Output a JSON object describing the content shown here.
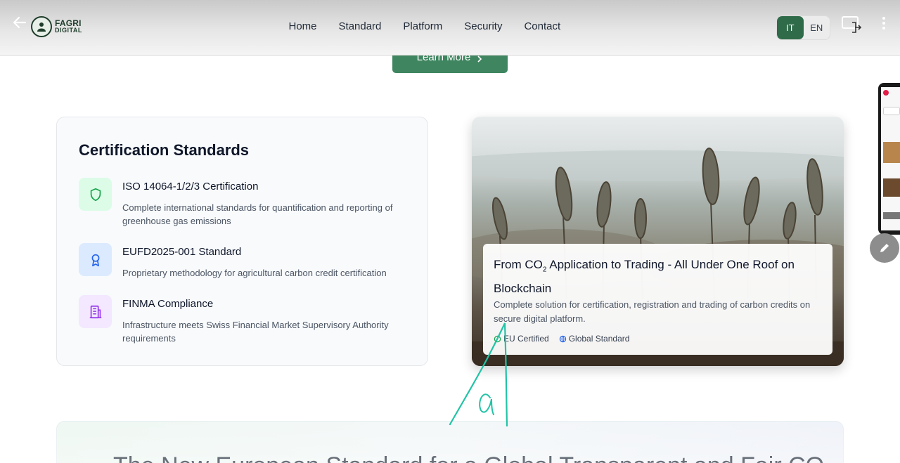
{
  "header": {
    "logo": {
      "line1": "FAGRI",
      "line2": "DIGITAL"
    },
    "nav": [
      "Home",
      "Standard",
      "Platform",
      "Security",
      "Contact"
    ],
    "lang": {
      "active": "IT",
      "inactive": "EN"
    }
  },
  "hero": {
    "learn_more": "Learn More"
  },
  "certification": {
    "title": "Certification Standards",
    "items": [
      {
        "title": "ISO 14064-1/2/3 Certification",
        "desc": "Complete international standards for quantification and reporting of greenhouse gas emissions",
        "icon": "shield-icon",
        "color": "#dcfce7"
      },
      {
        "title": "EUFD2025-001 Standard",
        "desc": "Proprietary methodology for agricultural carbon credit certification",
        "icon": "award-icon",
        "color": "#dbeafe"
      },
      {
        "title": "FINMA Compliance",
        "desc": "Infrastructure meets Swiss Financial Market Supervisory Authority requirements",
        "icon": "building-icon",
        "color": "#f3e8ff"
      }
    ]
  },
  "feature_card": {
    "title_pre": "From CO",
    "title_sub": "2",
    "title_post": " Application to Trading - All Under One Roof on Blockchain",
    "desc": "Complete solution for certification, registration and trading of carbon credits on secure digital platform.",
    "badges": [
      "EU Certified",
      "Global Standard"
    ]
  },
  "banner": {
    "title": "The New European Standard for a Global Transparent and Fair CO"
  },
  "colors": {
    "brand": "#2f6b49",
    "button": "#3f8660",
    "annotation": "#22c3a6"
  }
}
